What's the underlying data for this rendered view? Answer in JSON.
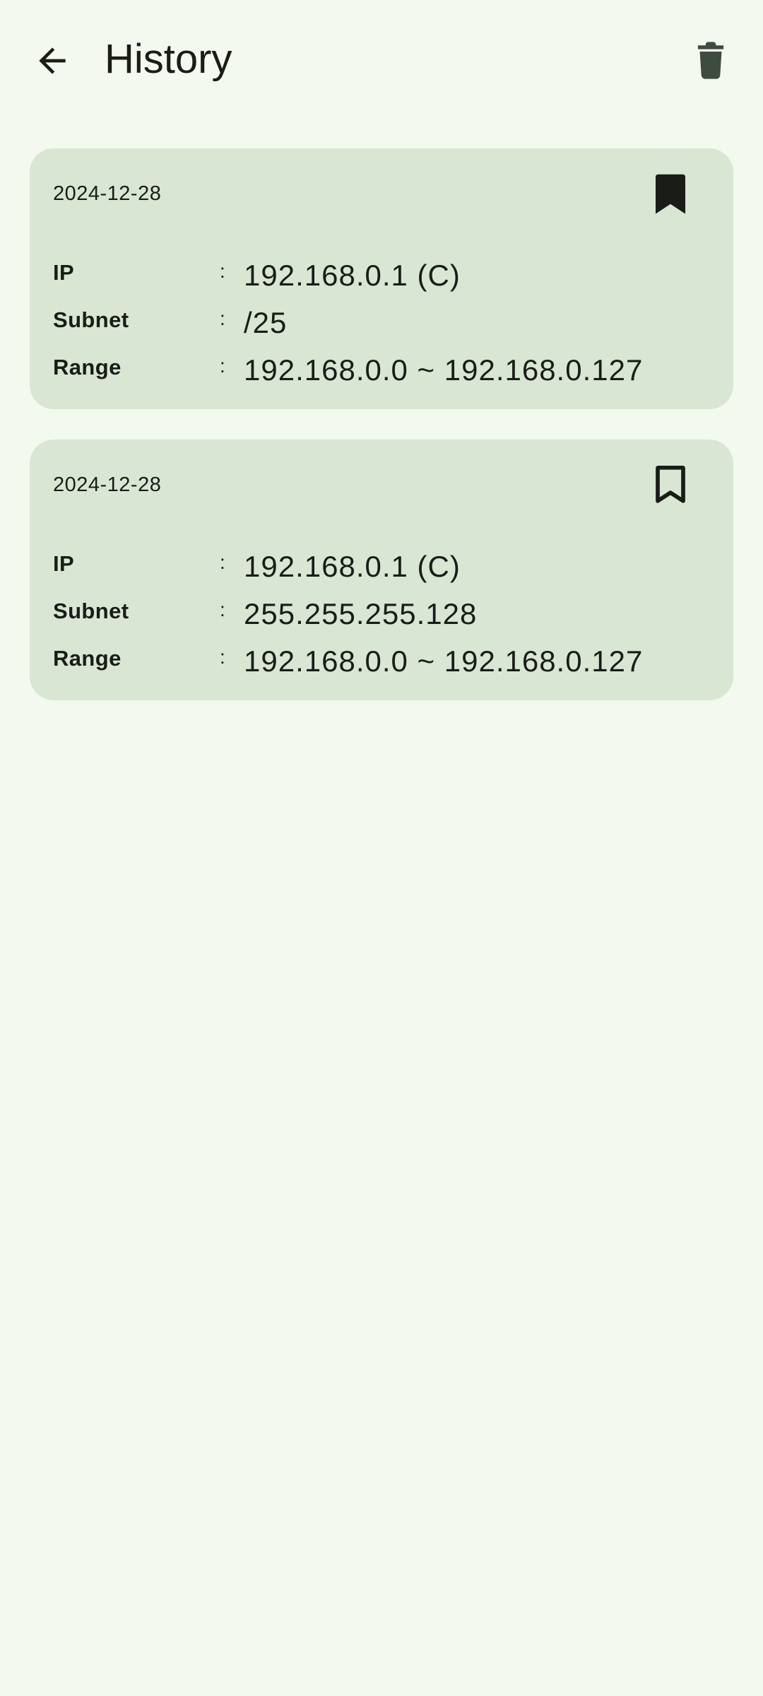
{
  "app_bar": {
    "title": "History",
    "back_icon": "arrow-back-icon",
    "delete_icon": "trash-icon"
  },
  "colors": {
    "background": "#f3f9ef",
    "card": "#d9e6d4",
    "text": "#1a1c18",
    "delete_icon": "#3f4b3e"
  },
  "history": [
    {
      "date": "2024-12-28",
      "bookmarked": true,
      "bookmark_icon": "bookmark-filled-icon",
      "rows": [
        {
          "label": "IP",
          "colon": ":",
          "value": "192.168.0.1 (C)"
        },
        {
          "label": "Subnet",
          "colon": ":",
          "value": "/25"
        },
        {
          "label": "Range",
          "colon": ":",
          "value": "192.168.0.0 ~ 192.168.0.127"
        }
      ]
    },
    {
      "date": "2024-12-28",
      "bookmarked": false,
      "bookmark_icon": "bookmark-outline-icon",
      "rows": [
        {
          "label": "IP",
          "colon": ":",
          "value": "192.168.0.1 (C)"
        },
        {
          "label": "Subnet",
          "colon": ":",
          "value": "255.255.255.128"
        },
        {
          "label": "Range",
          "colon": ":",
          "value": "192.168.0.0 ~ 192.168.0.127"
        }
      ]
    }
  ]
}
